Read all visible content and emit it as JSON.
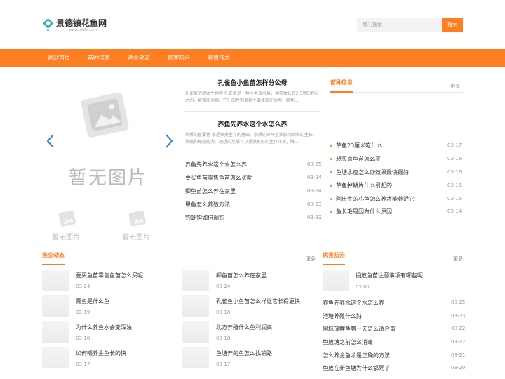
{
  "header": {
    "logo_title": "景德镇花鱼网",
    "logo_sub": "www.zdbks.com",
    "search_placeholder": "热门搜索",
    "search_button": "搜索"
  },
  "nav": [
    "网站首页",
    "苗种信息",
    "渔业动态",
    "病害防治",
    "养殖技术"
  ],
  "slider": {
    "placeholder_text": "暂无图片",
    "thumb_text": "暂无图片"
  },
  "featured": [
    {
      "title": "孔雀鱼小鱼苗怎样分公母",
      "summary": "孔雀鱼的基本生物学 孔雀鱼是一种小型淡水鱼，通常体长在2.5到5厘米之间。繁殖能力强。它们的性别差异主要体现在体型、颜色..."
    },
    {
      "title": "养鱼先养水这个水怎么养",
      "summary": "水质的重要性 水是鱼类生存的基础。水质的好坏直接影响到鱼的生长、繁殖和免疫能力。理想的水质可以提供良好的生存环境，降..."
    }
  ],
  "center_list": [
    {
      "title": "养鱼先养水这个水怎么养",
      "date": "03-25"
    },
    {
      "title": "要买鱼苗零售鱼苗怎么买呢",
      "date": "03-24"
    },
    {
      "title": "鲫鱼苗怎么养在家里",
      "date": "03-24"
    },
    {
      "title": "甲鱼怎么养殖方法",
      "date": "03-23"
    },
    {
      "title": "钓虾钩如何调钓",
      "date": "03-23"
    }
  ],
  "miao": {
    "title": "苗种信息",
    "more": "更多",
    "items": [
      {
        "title": "草鱼23厘米吃什么",
        "date": "03-17"
      },
      {
        "title": "想买点鱼苗怎么买",
        "date": "03-16"
      },
      {
        "title": "鱼塘水瘦怎么办效果最快最好",
        "date": "03-16"
      },
      {
        "title": "草鱼掉鳞片什么引起的",
        "date": "03-15"
      },
      {
        "title": "刚出生的小鱼怎么养才能养活它",
        "date": "03-15"
      },
      {
        "title": "鱼长毛是因为什么原因",
        "date": "03-14"
      }
    ]
  },
  "yuye": {
    "title": "渔业动态",
    "more": "更多",
    "left": [
      {
        "title": "要买鱼苗零售鱼苗怎么买呢",
        "date": "03-24"
      },
      {
        "title": "青鱼是什么鱼",
        "date": "03-19"
      },
      {
        "title": "为什么养鱼水会变浑浊",
        "date": "03-18"
      },
      {
        "title": "如何喂养金鱼长的快",
        "date": "03-17"
      }
    ],
    "right": [
      {
        "title": "鲫鱼苗怎么养在家里",
        "date": "03-24"
      },
      {
        "title": "孔雀鱼小鱼苗怎么样让它长得更快",
        "date": "03-18"
      },
      {
        "title": "北方养殖什么鱼利润高",
        "date": "03-18"
      },
      {
        "title": "鱼塘养的鱼怎么找销路",
        "date": "03-17"
      }
    ]
  },
  "bing": {
    "title": "病害防治",
    "more": "更多",
    "top": {
      "title": "投放鱼苗注意事项有哪些呢",
      "date": "07-01"
    },
    "items": [
      {
        "title": "养鱼先养水这个水怎么养",
        "date": "03-25"
      },
      {
        "title": "池塘养殖什么好",
        "date": "03-23"
      },
      {
        "title": "黑坑放鲤鱼第一天怎么适合重",
        "date": "03-22"
      },
      {
        "title": "鱼放塘之前怎么消毒",
        "date": "03-22"
      },
      {
        "title": "怎么养金鱼才是正确的方法",
        "date": "03-21"
      },
      {
        "title": "鱼放在新鱼塘为什么都死了",
        "date": "03-20"
      }
    ]
  },
  "colors": {
    "accent": "#ff7e22",
    "slider_arrow": "#2a7fd4"
  }
}
